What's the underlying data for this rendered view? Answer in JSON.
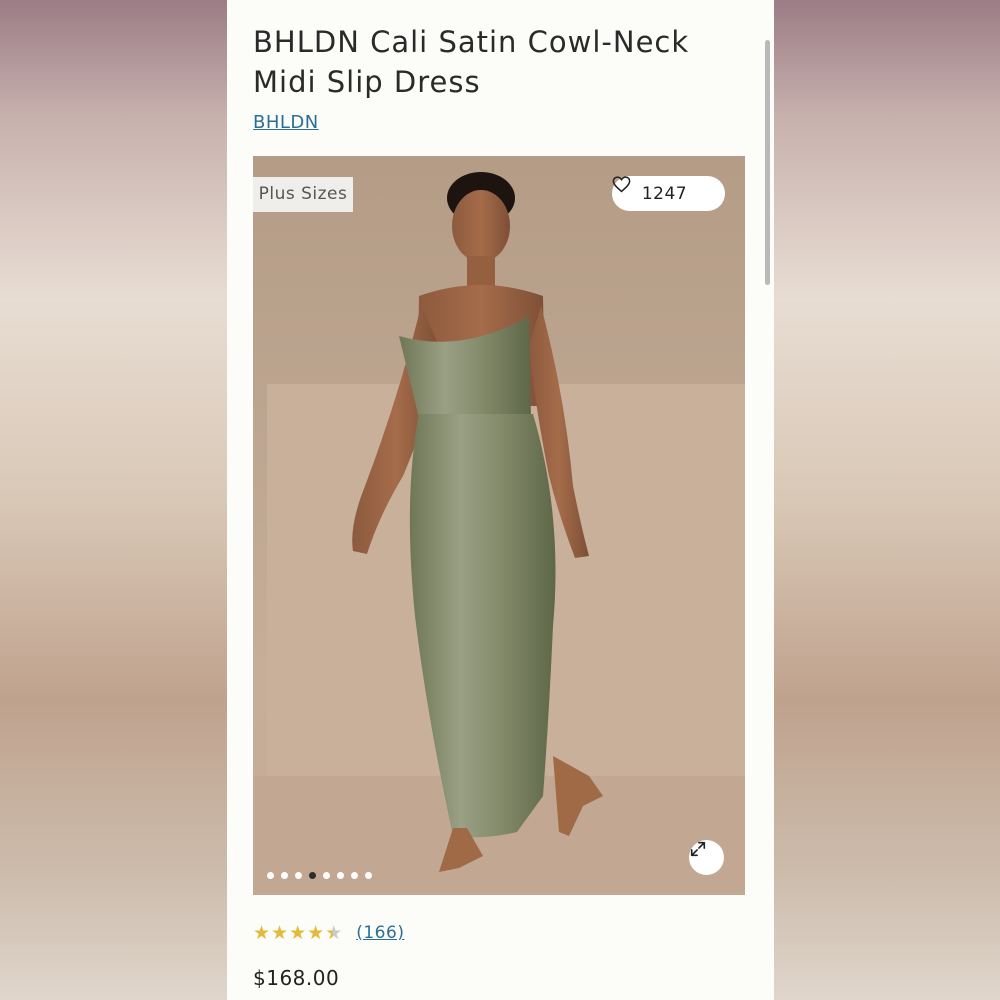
{
  "product": {
    "title": "BHLDN Cali Satin Cowl-Neck Midi Slip Dress",
    "brand": "BHLDN",
    "tag": "Plus Sizes",
    "likes": "1247",
    "rating": 4.5,
    "reviews_count": "(166)",
    "price": "$168.00"
  },
  "gallery": {
    "total_images": 8,
    "active_index": 3
  },
  "icons": {
    "like": "heart-outline-icon",
    "expand": "expand-arrows-icon",
    "star": "star-icon"
  },
  "colors": {
    "link": "#2b6f96",
    "star_filled": "#e5b93a",
    "star_empty": "#c9c9c9",
    "tag_bg": "#efeeea"
  }
}
